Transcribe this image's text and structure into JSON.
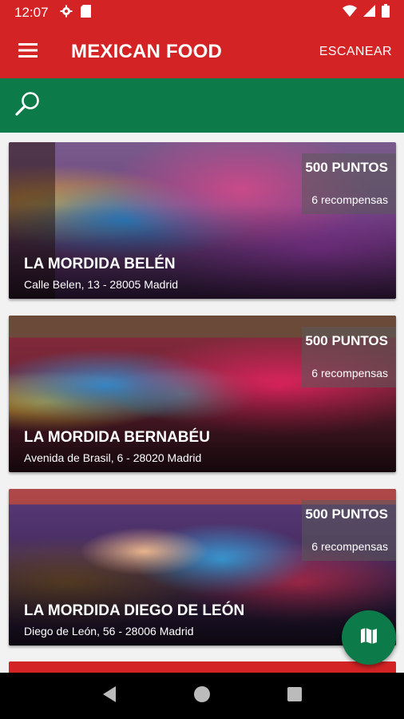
{
  "status": {
    "time": "12:07",
    "icons": [
      "settings-icon",
      "sd-card-icon",
      "wifi-icon",
      "signal-icon",
      "battery-icon"
    ]
  },
  "appbar": {
    "title": "MEXICAN FOOD",
    "scan_label": "ESCANEAR",
    "menu_icon": "hamburger-menu-icon"
  },
  "search": {
    "icon": "search-icon"
  },
  "restaurants": [
    {
      "points": "500 PUNTOS",
      "rewards": "6 recompensas",
      "name": "LA MORDIDA BELÉN",
      "address": "Calle Belen, 13 - 28005 Madrid"
    },
    {
      "points": "500 PUNTOS",
      "rewards": "6 recompensas",
      "name": "LA MORDIDA BERNABÉU",
      "address": "Avenida de Brasil, 6 - 28020 Madrid"
    },
    {
      "points": "500 PUNTOS",
      "rewards": "6 recompensas",
      "name": "LA MORDIDA DIEGO DE LEÓN",
      "address": "Diego de León, 56 - 28006 Madrid"
    }
  ],
  "fab": {
    "icon": "map-icon"
  },
  "navbar": {
    "icons": [
      "back-icon",
      "home-icon",
      "recents-icon"
    ]
  },
  "colors": {
    "primary_red": "#d32325",
    "primary_green": "#0d7a4a"
  }
}
